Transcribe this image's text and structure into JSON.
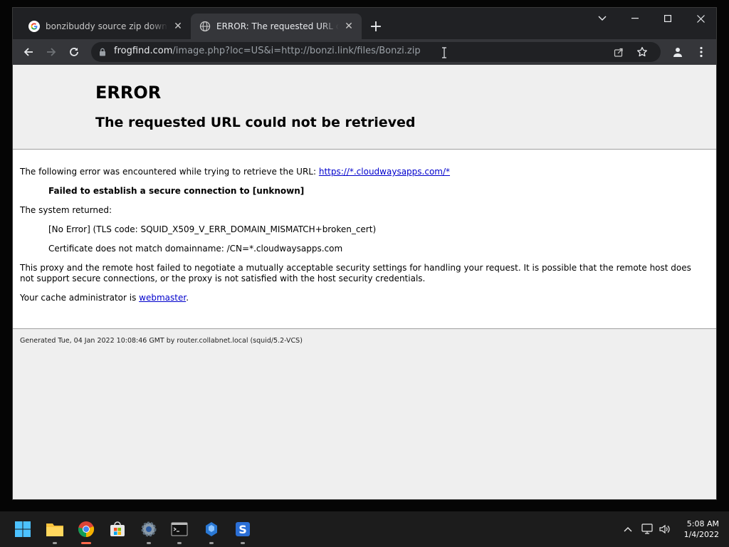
{
  "browser": {
    "tabs": [
      {
        "title": "bonzibuddy source zip downloa",
        "favicon": "google-g-icon",
        "active": false
      },
      {
        "title": "ERROR: The requested URL could",
        "favicon": "globe-icon",
        "active": true
      }
    ],
    "address": {
      "host": "frogfind.com",
      "path": "/image.php?loc=US&i=http://bonzi.link/files/Bonzi.zip"
    }
  },
  "page": {
    "title": "ERROR",
    "subtitle": "The requested URL could not be retrieved",
    "intro_text": "The following error was encountered while trying to retrieve the URL: ",
    "intro_link": "https://*.cloudwaysapps.com/*",
    "failure": "Failed to establish a secure connection to [unknown]",
    "system_returned": "The system returned:",
    "error_detail": "[No Error] (TLS code: SQUID_X509_V_ERR_DOMAIN_MISMATCH+broken_cert)",
    "cert_detail": "Certificate does not match domainname: /CN=*.cloudwaysapps.com",
    "explanation_line1": "This proxy and the remote host failed to negotiate a mutually acceptable security settings for handling your request. It is possible that the remote host does",
    "explanation_line2": "not support secure connections, or the proxy is not satisfied with the host security credentials.",
    "admin_prefix": "Your cache administrator is ",
    "admin_link": "webmaster",
    "admin_suffix": ".",
    "footer": "Generated Tue, 04 Jan 2022 10:08:46 GMT by router.collabnet.local (squid/5.2-VCS)"
  },
  "taskbar": {
    "apps": [
      "start-icon",
      "file-explorer-icon",
      "chrome-icon",
      "store-icon",
      "settings-icon",
      "terminal-icon",
      "network-app-icon",
      "s-app-icon"
    ],
    "clock": {
      "time": "5:08 AM",
      "date": "1/4/2022"
    }
  },
  "colors": {
    "link": "#0000cc",
    "tab_active": "#35363a",
    "chrome_dark": "#202124",
    "active_indicator": "#ff6a4d"
  }
}
